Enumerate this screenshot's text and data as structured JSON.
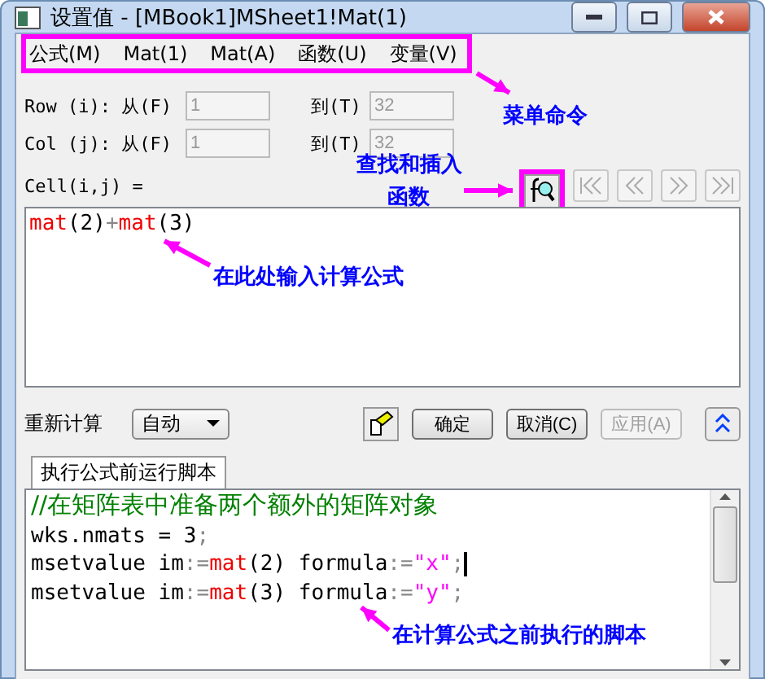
{
  "window": {
    "title": "设置值 - [MBook1]MSheet1!Mat(1)"
  },
  "menu": [
    "公式(M)",
    "Mat(1)",
    "Mat(A)",
    "函数(U)",
    "变量(V)"
  ],
  "ranges": [
    {
      "label": "Row (i): 从(F)",
      "from": "1",
      "to_label": "到(T)",
      "to": "32"
    },
    {
      "label": "Col (j): 从(F)",
      "from": "1",
      "to_label": "到(T)",
      "to": "32"
    }
  ],
  "cell_label": "Cell(i,j) =",
  "formula": [
    {
      "kind": "func",
      "text": "mat"
    },
    {
      "kind": "plain",
      "text": "(2)"
    },
    {
      "kind": "op",
      "text": "+"
    },
    {
      "kind": "func",
      "text": "mat"
    },
    {
      "kind": "plain",
      "text": "(3)"
    }
  ],
  "recalc": {
    "label": "重新计算",
    "value": "自动"
  },
  "buttons": [
    {
      "label": "确定",
      "disabled": false
    },
    {
      "label": "取消(C)",
      "disabled": false
    },
    {
      "label": "应用(A)",
      "disabled": true
    }
  ],
  "tabs": [
    {
      "label": "执行公式前运行脚本",
      "selected": true
    }
  ],
  "script": [
    [
      {
        "kind": "comment",
        "text": "//在矩阵表中准备两个额外的矩阵对象"
      }
    ],
    [
      {
        "kind": "plain",
        "text": "wks.nmats = 3"
      },
      {
        "kind": "op",
        "text": ";"
      }
    ],
    [
      {
        "kind": "plain",
        "text": "msetvalue im"
      },
      {
        "kind": "op",
        "text": ":="
      },
      {
        "kind": "func",
        "text": "mat"
      },
      {
        "kind": "plain",
        "text": "(2) formula"
      },
      {
        "kind": "op",
        "text": ":="
      },
      {
        "kind": "string",
        "text": "\"x\""
      },
      {
        "kind": "op",
        "text": ";"
      }
    ],
    [
      {
        "kind": "plain",
        "text": "msetvalue im"
      },
      {
        "kind": "op",
        "text": ":="
      },
      {
        "kind": "func",
        "text": "mat"
      },
      {
        "kind": "plain",
        "text": "(3) formula"
      },
      {
        "kind": "op",
        "text": ":="
      },
      {
        "kind": "string",
        "text": "\"y\""
      },
      {
        "kind": "op",
        "text": ";"
      }
    ]
  ],
  "annotations": [
    {
      "text": "菜单命令"
    },
    {
      "text": "查找和插入"
    },
    {
      "text": "函数"
    },
    {
      "text": "在此处输入计算公式"
    },
    {
      "text": "在计算公式之前执行的脚本"
    }
  ]
}
